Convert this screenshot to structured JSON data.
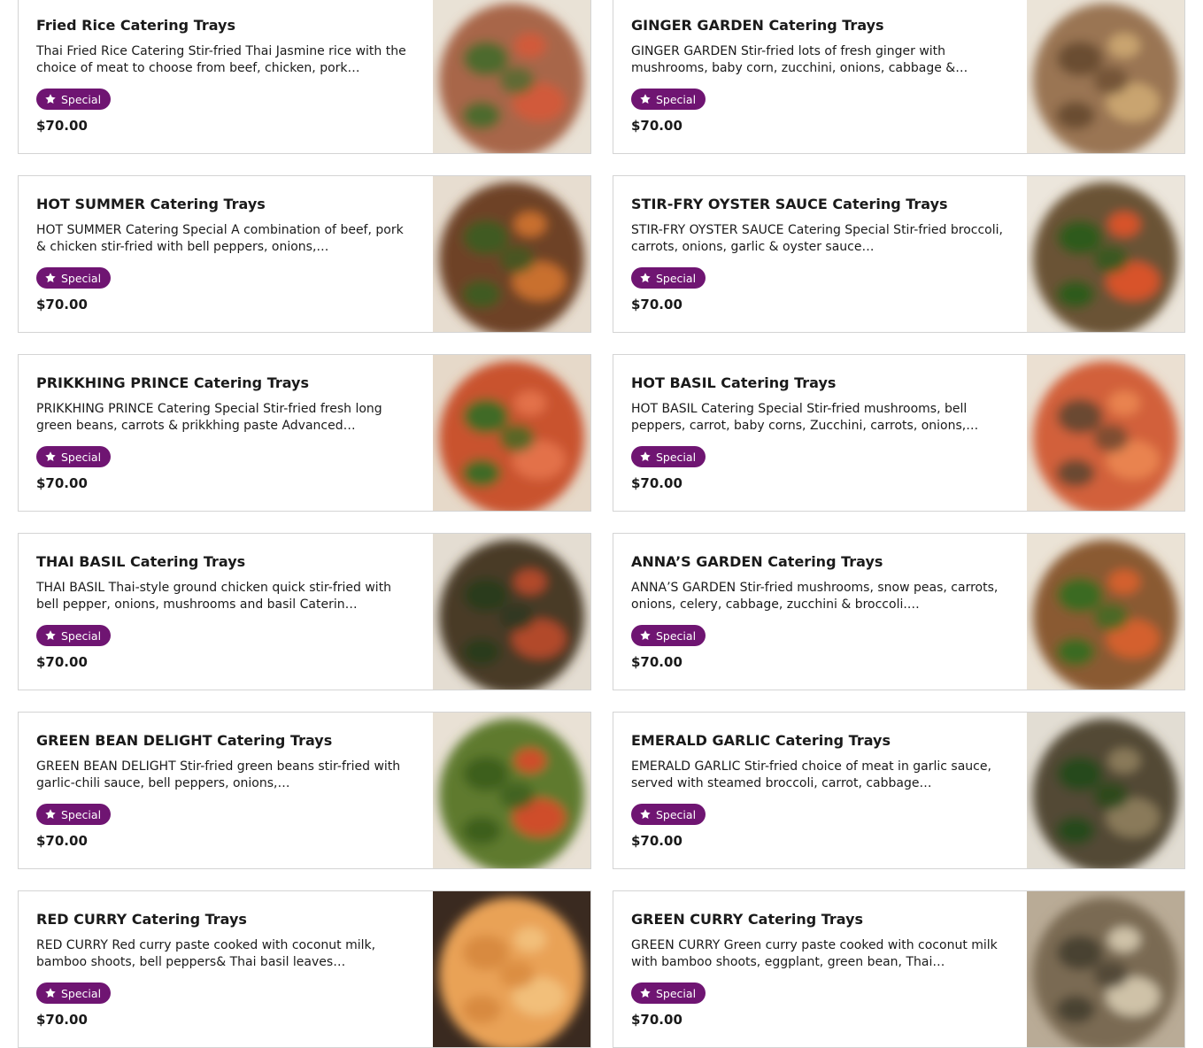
{
  "menu": {
    "items": [
      {
        "title": "Fried Rice Catering Trays",
        "description": "Thai Fried Rice Catering Stir-fried Thai Jasmine rice with the choice of meat to choose from beef, chicken, pork…",
        "badge": "Special",
        "price": "$70.00",
        "image": {
          "plate": "#e9e2d6",
          "food": "#a8664a",
          "accent": "#4e6b2f",
          "highlight": "#d15a3a"
        }
      },
      {
        "title": "GINGER GARDEN Catering Trays",
        "description": "GINGER GARDEN Stir-fried lots of fresh ginger with mushrooms, baby corn, zucchini, onions, cabbage &…",
        "badge": "Special",
        "price": "$70.00",
        "image": {
          "plate": "#ebe4d8",
          "food": "#9a7552",
          "accent": "#6a4e33",
          "highlight": "#c9a46f"
        }
      },
      {
        "title": "HOT SUMMER Catering Trays",
        "description": "HOT SUMMER Catering Special A combination of beef, pork & chicken stir-fried with bell peppers, onions,…",
        "badge": "Special",
        "price": "$70.00",
        "image": {
          "plate": "#e7ddd0",
          "food": "#6e4326",
          "accent": "#3f5a24",
          "highlight": "#c9702f"
        }
      },
      {
        "title": "STIR-FRY OYSTER SAUCE Catering Trays",
        "description": "STIR-FRY OYSTER SAUCE Catering Special Stir-fried broccoli, carrots, onions, garlic & oyster sauce…",
        "badge": "Special",
        "price": "$70.00",
        "image": {
          "plate": "#ece6dc",
          "food": "#6b5234",
          "accent": "#2f5a1e",
          "highlight": "#d8532c"
        }
      },
      {
        "title": "PRIKKHING PRINCE Catering Trays",
        "description": "PRIKKHING PRINCE Catering Special Stir-fried fresh long green beans, carrots & prikkhing paste Advanced…",
        "badge": "Special",
        "price": "$70.00",
        "image": {
          "plate": "#e6d9c9",
          "food": "#c9532d",
          "accent": "#3f6b25",
          "highlight": "#e3714a"
        }
      },
      {
        "title": "HOT BASIL Catering Trays",
        "description": "HOT BASIL Catering Special Stir-fried mushrooms, bell peppers, carrot, baby corns, Zucchini, carrots, onions,…",
        "badge": "Special",
        "price": "$70.00",
        "image": {
          "plate": "#ebe0d2",
          "food": "#d2603a",
          "accent": "#6a4a30",
          "highlight": "#e9834f"
        }
      },
      {
        "title": "THAI BASIL Catering Trays",
        "description": "THAI BASIL Thai-style ground chicken quick stir-fried with bell pepper, onions, mushrooms and basil Caterin…",
        "badge": "Special",
        "price": "$70.00",
        "image": {
          "plate": "#e4ddd2",
          "food": "#4a3a28",
          "accent": "#2a3a1e",
          "highlight": "#b24a2c"
        }
      },
      {
        "title": "ANNA’S GARDEN Catering Trays",
        "description": "ANNA’S GARDEN Stir-fried mushrooms, snow peas, carrots, onions, celery, cabbage, zucchini & broccoli.…",
        "badge": "Special",
        "price": "$70.00",
        "image": {
          "plate": "#ebe3d6",
          "food": "#8a5a32",
          "accent": "#3b6a22",
          "highlight": "#d4602e"
        }
      },
      {
        "title": "GREEN BEAN DELIGHT Catering Trays",
        "description": "GREEN BEAN DELIGHT Stir-fried green beans stir-fried with garlic-chili sauce, bell peppers, onions,…",
        "badge": "Special",
        "price": "$70.00",
        "image": {
          "plate": "#e9e1d5",
          "food": "#5f7a2e",
          "accent": "#3c5e1f",
          "highlight": "#cf4e2c"
        }
      },
      {
        "title": "EMERALD GARLIC Catering Trays",
        "description": "EMERALD GARLIC Stir-fried choice of meat in garlic sauce, served with steamed broccoli, carrot, cabbage…",
        "badge": "Special",
        "price": "$70.00",
        "image": {
          "plate": "#e2ddd3",
          "food": "#524a36",
          "accent": "#27491a",
          "highlight": "#8a7a5a"
        }
      },
      {
        "title": "RED CURRY Catering Trays",
        "description": "RED CURRY Red curry paste cooked with coconut milk, bamboo shoots, bell peppers& Thai basil leaves…",
        "badge": "Special",
        "price": "$70.00",
        "image": {
          "plate": "#3a2a20",
          "food": "#e9a257",
          "accent": "#d88a3f",
          "highlight": "#f2bf7a"
        }
      },
      {
        "title": "GREEN CURRY Catering Trays",
        "description": "GREEN CURRY Green curry paste cooked with coconut milk with bamboo shoots, eggplant, green bean, Thai…",
        "badge": "Special",
        "price": "$70.00",
        "image": {
          "plate": "#b9ab96",
          "food": "#7a6a52",
          "accent": "#4a4232",
          "highlight": "#cfc2a8"
        }
      }
    ]
  }
}
